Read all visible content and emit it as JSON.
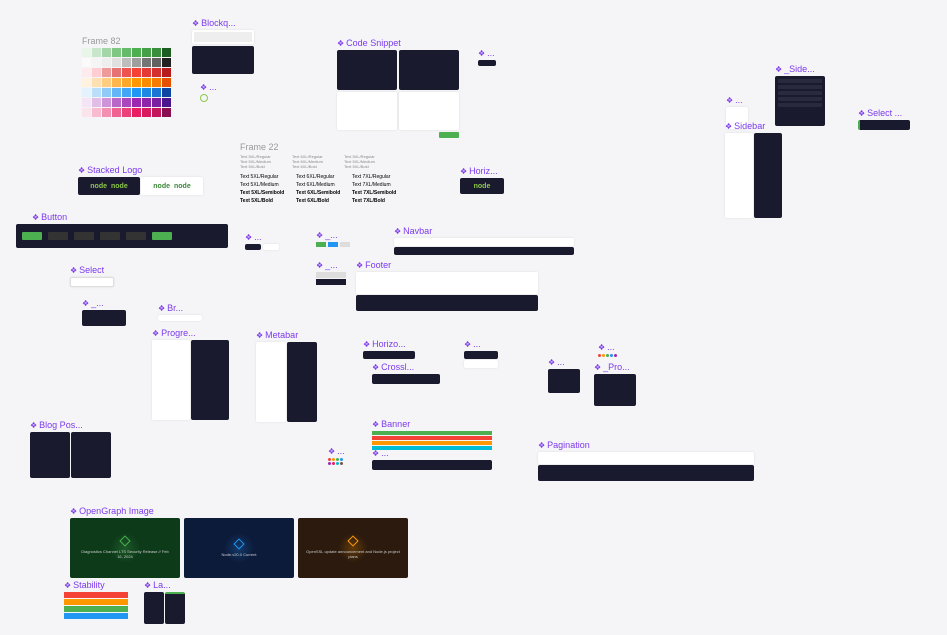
{
  "frame82": {
    "label": "Frame 82"
  },
  "frame22": {
    "label": "Frame 22"
  },
  "blockquote": {
    "label": "Blockq..."
  },
  "codesnippet": {
    "label": "Code Snippet"
  },
  "stackedlogo": {
    "label": "Stacked Logo",
    "text": "node"
  },
  "button": {
    "label": "Button"
  },
  "select": {
    "label": "Select"
  },
  "breadcrumb": {
    "label": "Br..."
  },
  "progress": {
    "label": "Progre..."
  },
  "metabar": {
    "label": "Metabar"
  },
  "horizontal": {
    "label": "Horizo..."
  },
  "crosslink": {
    "label": "Crossl..."
  },
  "banner": {
    "label": "Banner"
  },
  "blogpost": {
    "label": "Blog Pos..."
  },
  "opengraph": {
    "label": "OpenGraph Image"
  },
  "stability": {
    "label": "Stability"
  },
  "language": {
    "label": "La..."
  },
  "pagination": {
    "label": "Pagination"
  },
  "navbar": {
    "label": "Navbar"
  },
  "footer": {
    "label": "Footer"
  },
  "sidebar": {
    "label": "Sidebar"
  },
  "sidedark": {
    "label": "_Side..."
  },
  "selectdark": {
    "label": "Select ..."
  },
  "horiz2": {
    "label": "Horiz..."
  },
  "profile": {
    "label": "_Pro..."
  },
  "dots1": {
    "label": "..."
  },
  "dots2": {
    "label": "..."
  },
  "dots3": {
    "label": "..."
  },
  "dots4": {
    "label": "..."
  },
  "dots5": {
    "label": "..."
  },
  "dots6": {
    "label": "..."
  },
  "dots7": {
    "label": "..."
  },
  "dots8": {
    "label": "..."
  },
  "dots9": {
    "label": "..."
  },
  "underscore1": {
    "label": "_..."
  },
  "underscore2": {
    "label": "_..."
  },
  "underscore3": {
    "label": "_..."
  },
  "typography": {
    "rows": [
      [
        "Text 5XL/Regular",
        "Text 6XL/Regular",
        "Text 7XL/Regular"
      ],
      [
        "Text 5XL/Medium",
        "Text 6XL/Medium",
        "Text 7XL/Medium"
      ],
      [
        "Text 5XL/Semibold",
        "Text 6XL/Semibold",
        "Text 7XL/Semibold"
      ],
      [
        "Text 5XL/Bold",
        "Text 6XL/Bold",
        "Text 7XL/Bold"
      ]
    ]
  },
  "palette_colors": [
    [
      "#e8f5e9",
      "#c8e6c9",
      "#a5d6a7",
      "#81c784",
      "#66bb6a",
      "#4caf50",
      "#43a047",
      "#388e3c",
      "#1b5e20"
    ],
    [
      "#fafafa",
      "#f5f5f5",
      "#eeeeee",
      "#e0e0e0",
      "#bdbdbd",
      "#9e9e9e",
      "#757575",
      "#616161",
      "#212121"
    ],
    [
      "#ffebee",
      "#ffcdd2",
      "#ef9a9a",
      "#e57373",
      "#ef5350",
      "#f44336",
      "#e53935",
      "#d32f2f",
      "#b71c1c"
    ],
    [
      "#fff3e0",
      "#ffe0b2",
      "#ffcc80",
      "#ffb74d",
      "#ffa726",
      "#ff9800",
      "#fb8c00",
      "#f57c00",
      "#e65100"
    ],
    [
      "#e3f2fd",
      "#bbdefb",
      "#90caf9",
      "#64b5f6",
      "#42a5f5",
      "#2196f3",
      "#1e88e5",
      "#1976d2",
      "#0d47a1"
    ],
    [
      "#f3e5f5",
      "#e1bee7",
      "#ce93d8",
      "#ba68c8",
      "#ab47bc",
      "#9c27b0",
      "#8e24aa",
      "#7b1fa2",
      "#4a148c"
    ],
    [
      "#fce4ec",
      "#f8bbd0",
      "#f48fb1",
      "#f06292",
      "#ec407a",
      "#e91e63",
      "#d81b60",
      "#c2185b",
      "#880e4f"
    ]
  ],
  "og_cards": [
    {
      "bg": "#0d3b1a",
      "glow": "#4caf50",
      "text": "Diagnostics Channel LTS Security Release // Feb 16, 2024"
    },
    {
      "bg": "#0d1b3b",
      "glow": "#2196f3",
      "text": "Node.v20.0 Current"
    },
    {
      "bg": "#2b1a0d",
      "glow": "#ff9800",
      "text": "OpenSSL update announcement and Node.js project plans"
    }
  ]
}
